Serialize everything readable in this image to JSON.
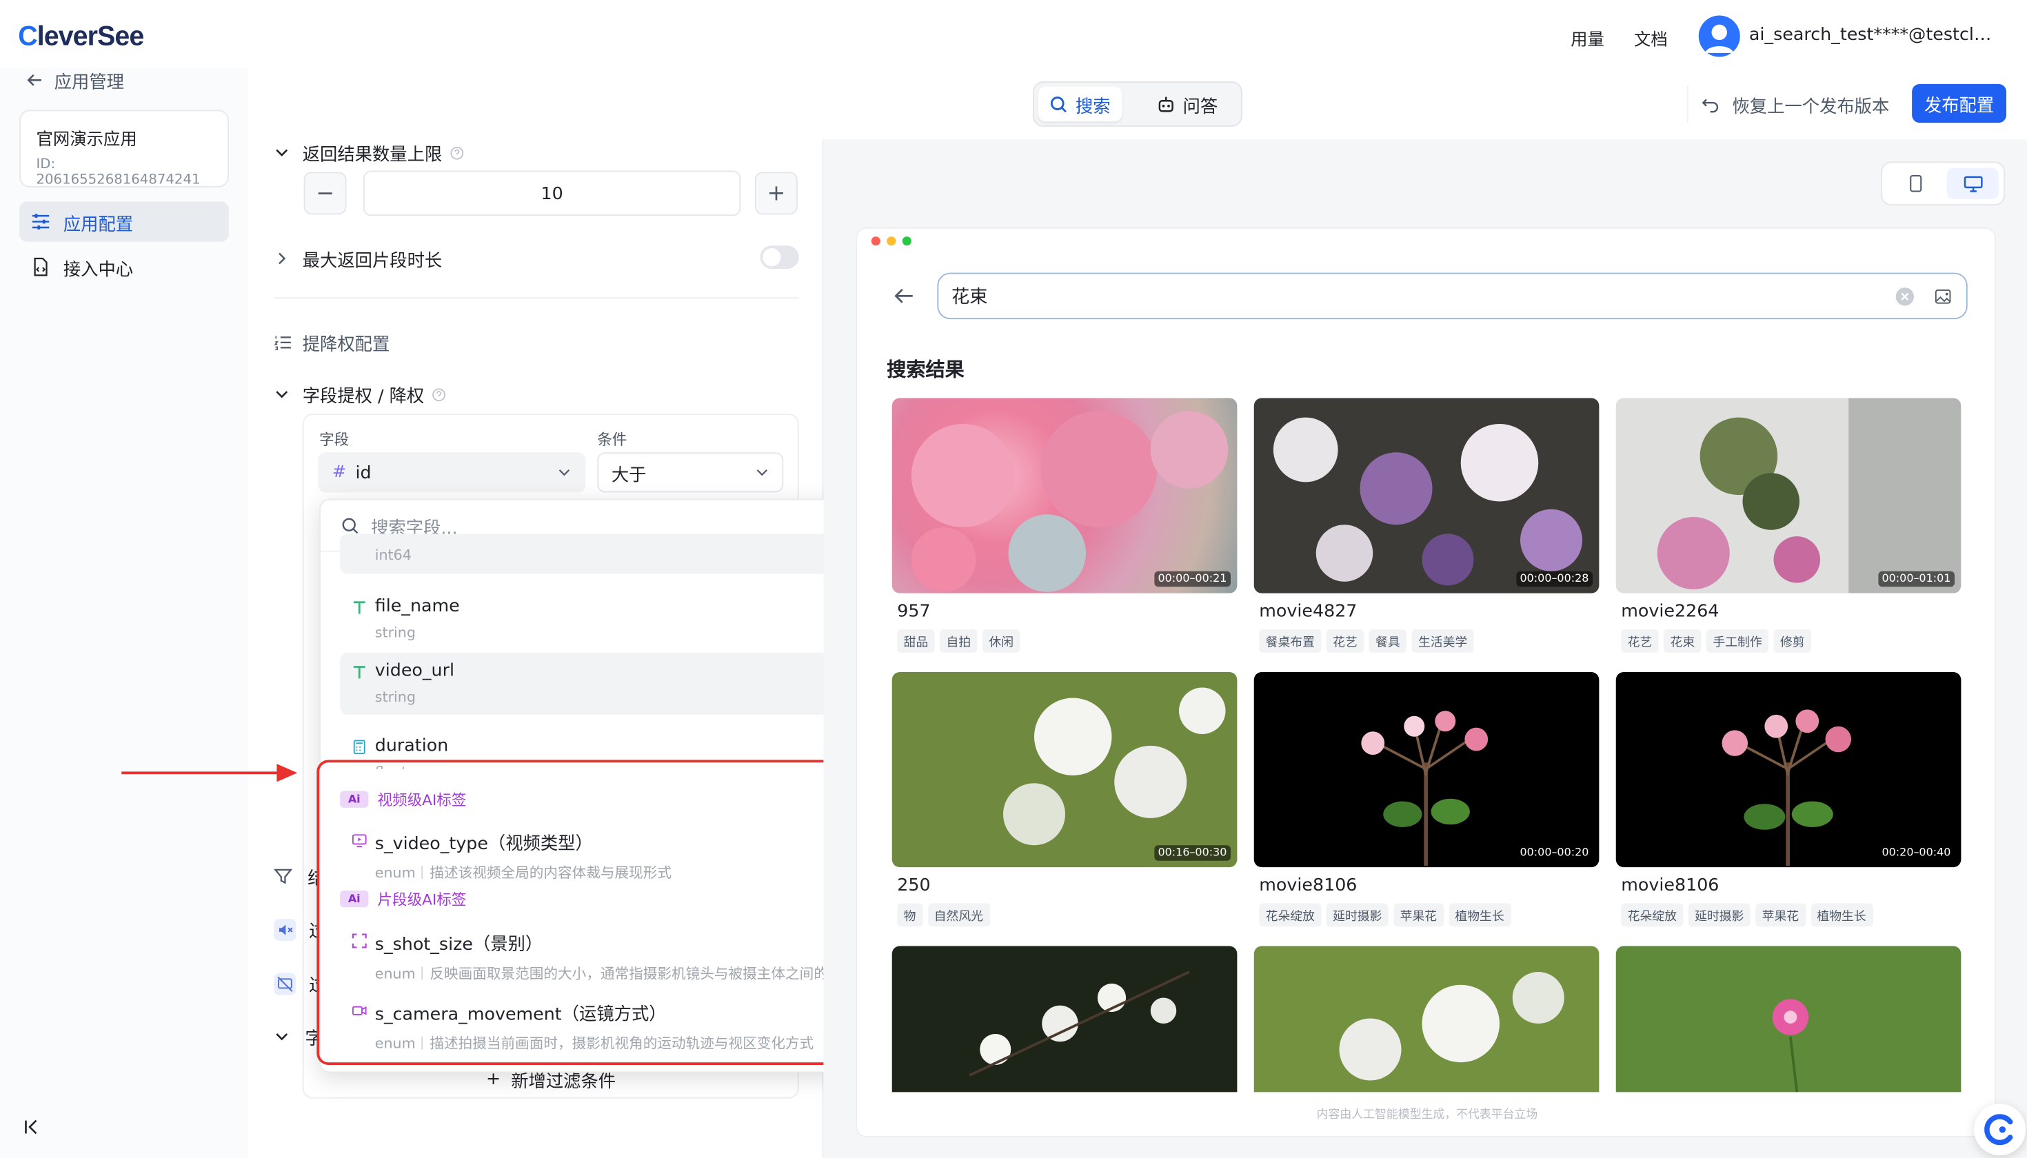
{
  "header": {
    "logo_prefix": "C",
    "logo_suffix": "leverSee",
    "links": [
      "用量",
      "文档"
    ],
    "user": "ai_search_test****@testclo..."
  },
  "sidebar": {
    "back_label": "应用管理",
    "app": {
      "name": "官网演示应用",
      "id": "ID: 2061655268164874241"
    },
    "items": [
      {
        "label": "应用配置",
        "icon": "sliders-icon",
        "active": true
      },
      {
        "label": "接入中心",
        "icon": "file-code-icon",
        "active": false
      }
    ]
  },
  "toolbar": {
    "tabs": [
      {
        "label": "搜索",
        "active": true
      },
      {
        "label": "问答",
        "active": false
      }
    ],
    "restore_label": "恢复上一个发布版本",
    "publish_label": "发布配置"
  },
  "config": {
    "max_results": {
      "label": "返回结果数量上限",
      "value": "10"
    },
    "max_clip": {
      "label": "最大返回片段时长",
      "enabled": false
    },
    "rank_section": "提降权配置",
    "field_boost": {
      "label": "字段提权 / 降权",
      "field_label": "字段",
      "field_value": "id",
      "cond_label": "条件",
      "cond_value": "大于"
    },
    "hidden_rows": [
      "结",
      "过",
      "过",
      "字"
    ],
    "add_filter": "新增过滤条件"
  },
  "dropdown": {
    "search_placeholder": "搜索字段...",
    "partial_type": "int64",
    "options": [
      {
        "name": "file_name",
        "type": "string",
        "icon": "text-icon"
      },
      {
        "name": "video_url",
        "type": "string",
        "icon": "text-icon"
      },
      {
        "name": "duration",
        "type": "float",
        "icon": "calculator-icon"
      }
    ],
    "groups": [
      {
        "badge": "Ai",
        "label": "视频级AI标签",
        "options": [
          {
            "name": "s_video_type（视频类型）",
            "type": "enum",
            "desc": "描述该视频全局的内容体裁与展现形式",
            "icon": "video-icon"
          }
        ]
      },
      {
        "badge": "Ai",
        "label": "片段级AI标签",
        "options": [
          {
            "name": "s_shot_size（景别）",
            "type": "enum",
            "desc": "反映画面取景范围的大小，通常指摄影机镜头与被摄主体之间的距离感",
            "icon": "frame-icon"
          },
          {
            "name": "s_camera_movement（运镜方式）",
            "type": "enum",
            "desc": "描述拍摄当前画面时，摄影机视角的运动轨迹与视区变化方式",
            "icon": "camera-icon"
          }
        ]
      }
    ]
  },
  "preview": {
    "query": "花束",
    "results_title": "搜索结果",
    "cards": [
      {
        "name": "957",
        "duration": "00:00–00:21",
        "tags": [
          "甜品",
          "自拍",
          "休闲"
        ]
      },
      {
        "name": "movie4827",
        "duration": "00:00–00:28",
        "tags": [
          "餐桌布置",
          "花艺",
          "餐具",
          "生活美学"
        ]
      },
      {
        "name": "movie2264",
        "duration": "00:00–01:01",
        "tags": [
          "花艺",
          "花束",
          "手工制作",
          "修剪"
        ]
      },
      {
        "name": "250",
        "duration": "00:16–00:30",
        "tags": [
          "物",
          "自然风光"
        ]
      },
      {
        "name": "movie8106",
        "duration": "00:00–00:20",
        "tags": [
          "花朵绽放",
          "延时摄影",
          "苹果花",
          "植物生长"
        ]
      },
      {
        "name": "movie8106",
        "duration": "00:20–00:40",
        "tags": [
          "花朵绽放",
          "延时摄影",
          "苹果花",
          "植物生长"
        ]
      }
    ],
    "disclaimer": "内容由人工智能模型生成，不代表平台立场"
  },
  "colors": {
    "accent": "#1f60f2",
    "highlight": "#e8312e",
    "ai_purple": "#a338d8"
  }
}
